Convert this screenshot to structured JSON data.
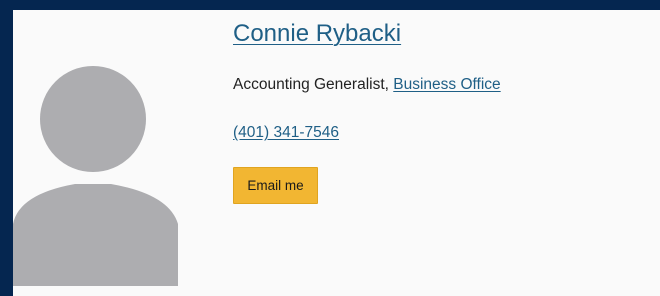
{
  "profile": {
    "name": "Connie Rybacki",
    "job_title": "Accounting Generalist,",
    "department": "Business Office",
    "phone": "(401) 341-7546",
    "email_button_label": "Email me"
  },
  "icons": {
    "avatar": "person-silhouette-icon"
  },
  "colors": {
    "frame": "#052650",
    "card_background": "#fafafa",
    "link": "#1f5f86",
    "button": "#f2b632",
    "silhouette": "#adadb0"
  }
}
